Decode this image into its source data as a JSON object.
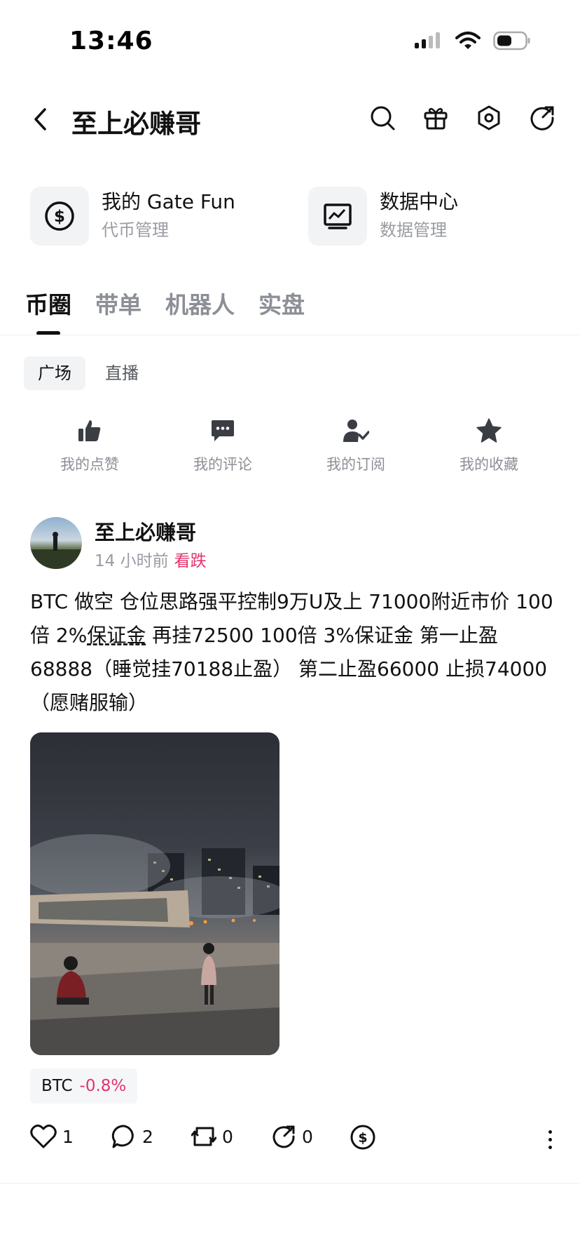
{
  "status_bar": {
    "time": "13:46"
  },
  "header": {
    "title": "至上必赚哥"
  },
  "quick_cards": [
    {
      "title": "我的 Gate Fun",
      "subtitle": "代币管理",
      "icon": "dollar-circle-icon"
    },
    {
      "title": "数据中心",
      "subtitle": "数据管理",
      "icon": "chart-monitor-icon"
    }
  ],
  "main_tabs": [
    {
      "label": "币圈",
      "active": true
    },
    {
      "label": "带单",
      "active": false
    },
    {
      "label": "机器人",
      "active": false
    },
    {
      "label": "实盘",
      "active": false
    }
  ],
  "sub_tabs": [
    {
      "label": "广场",
      "active": true
    },
    {
      "label": "直播",
      "active": false
    }
  ],
  "my_items": [
    {
      "label": "我的点赞",
      "icon": "thumbs-up-icon"
    },
    {
      "label": "我的评论",
      "icon": "comment-icon"
    },
    {
      "label": "我的订阅",
      "icon": "subscribe-icon"
    },
    {
      "label": "我的收藏",
      "icon": "star-icon"
    }
  ],
  "post": {
    "author": "至上必赚哥",
    "time": "14 小时前",
    "sentiment": "看跌",
    "body_part1": "BTC 做空 仓位思路强平控制9万U及上 71000附近市价 100倍 2%",
    "body_underlined": "保证金",
    "body_part2": " 再挂72500 100倍 3%保证金 第一止盈68888（睡觉挂70188止盈） 第二止盈66000 止损74000（愿赌服输）",
    "coin": {
      "name": "BTC",
      "change": "-0.8%"
    },
    "counts": {
      "likes": "1",
      "comments": "2",
      "reposts": "0",
      "shares": "0"
    }
  },
  "colors": {
    "accent_negative": "#e2356b",
    "muted": "#9a9ca3",
    "surface": "#f2f3f5"
  }
}
